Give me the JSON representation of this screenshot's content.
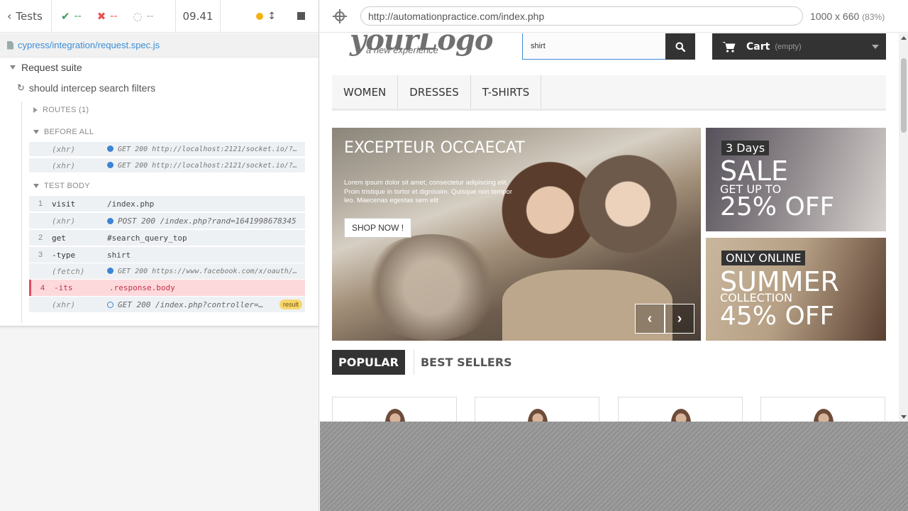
{
  "reporter": {
    "back_label": "Tests",
    "passed": "--",
    "failed": "--",
    "pending": "--",
    "duration": "09.41",
    "spec_path": "cypress/integration/request.spec.js",
    "suite_title": "Request suite",
    "test_title": "should intercep search filters",
    "routes_label": "ROUTES (1)",
    "before_all_label": "BEFORE ALL",
    "test_body_label": "TEST BODY",
    "before_all_cmds": [
      {
        "name": "(xhr)",
        "message": "GET 200 http://localhost:2121/socket.io/?tok…"
      },
      {
        "name": "(xhr)",
        "message": "GET 200 http://localhost:2121/socket.io/?tok…"
      }
    ],
    "test_cmds": [
      {
        "num": "1",
        "name": "visit",
        "message": "/index.php"
      },
      {
        "num": "",
        "name": "(xhr)",
        "message": "POST 200 /index.php?rand=1641998678345"
      },
      {
        "num": "2",
        "name": "get",
        "message": "#search_query_top"
      },
      {
        "num": "3",
        "name": "-type",
        "message": "shirt"
      },
      {
        "num": "",
        "name": "(fetch)",
        "message": "GET 200 https://www.facebook.com/x/oauth/sta…"
      },
      {
        "num": "4",
        "name": "-its",
        "message": ".response.body"
      },
      {
        "num": "",
        "name": "(xhr)",
        "message": "GET 200 /index.php?controller=…",
        "badge": "result"
      }
    ]
  },
  "aut": {
    "url": "http://automationpractice.com/index.php",
    "viewport": "1000 x 660",
    "zoom": "(83%)"
  },
  "site": {
    "logo": "yourLogo",
    "logo_sub": "a new experience",
    "search_value": "shirt",
    "cart_label": "Cart",
    "cart_status": "(empty)",
    "menu": [
      "Women",
      "Dresses",
      "T-shirts"
    ],
    "slide_title": "Exceptеur Occaecat",
    "slide_text": "Lorem ipsum dolor sit amet, consectetur adipiscing elit. Proin tristique in tortor et dignissim. Quisque non tempor leo. Maecenas egestas sem elit",
    "shop_now": "SHOP NOW !",
    "promo1": {
      "tag": "3 Days",
      "big": "SALE",
      "mid": "GET UP TO",
      "deal": "25% OFF"
    },
    "promo2": {
      "tag": "ONLY ONLINE",
      "big": "SUMMER",
      "mid": "COLLECTION",
      "deal": "45% OFF"
    },
    "tabs": [
      "Popular",
      "Best Sellers"
    ]
  },
  "colors": {
    "pass": "#3a9a5a",
    "fail": "#e94f4f",
    "link": "#3b8ed6",
    "failed_row_bg": "#fdd9dc"
  }
}
